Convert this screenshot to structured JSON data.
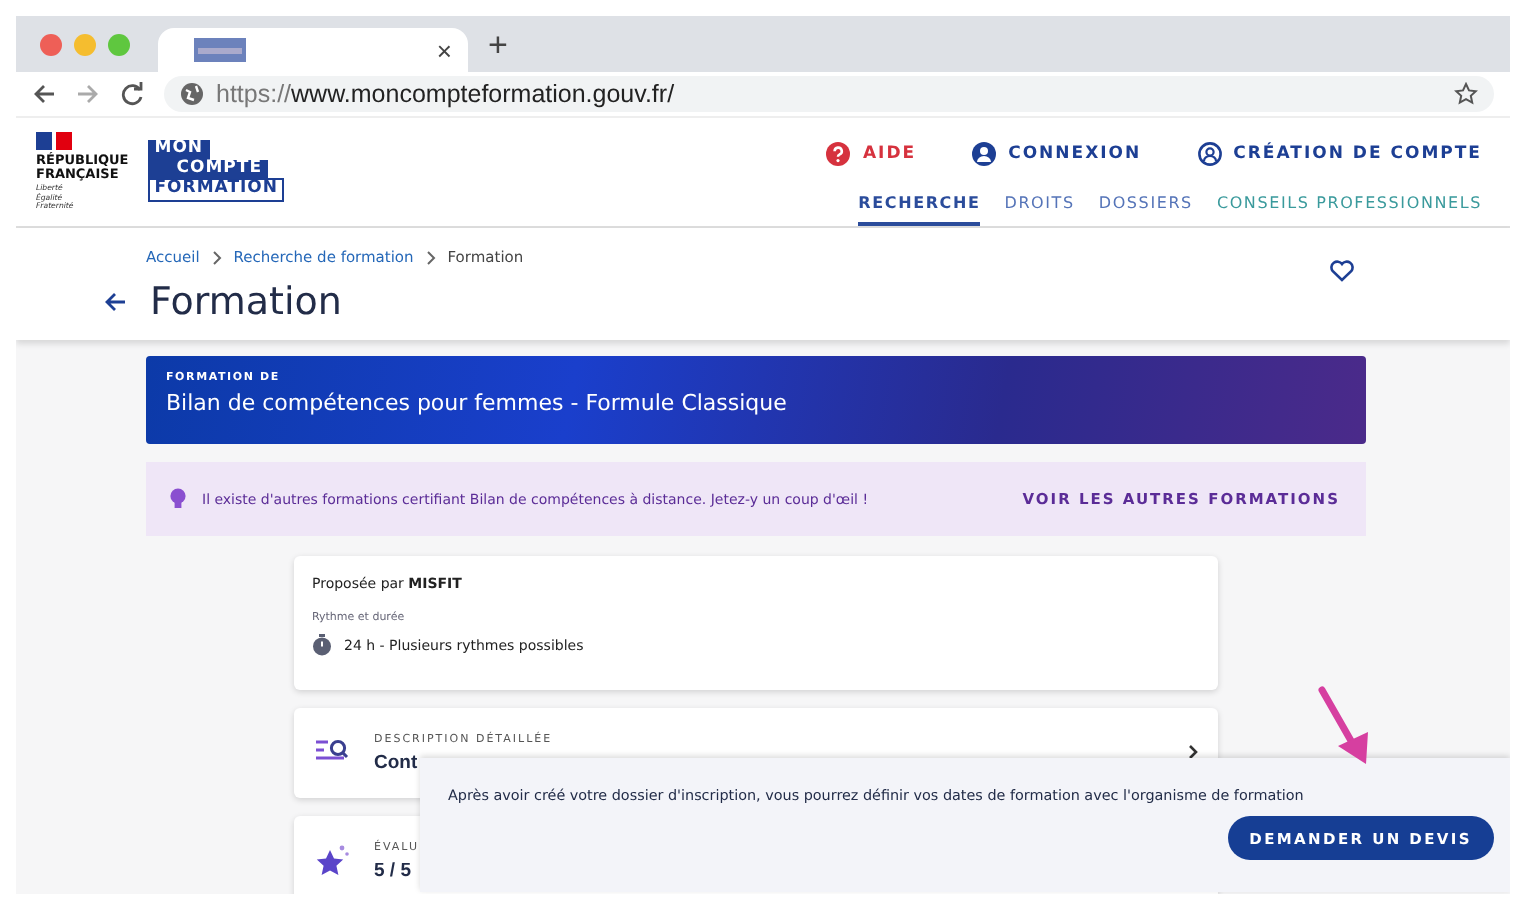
{
  "browser": {
    "tab_close": "×",
    "new_tab": "+",
    "url_scheme": "https://",
    "url_host": "www.moncompteformation.gouv.fr/"
  },
  "header": {
    "republique": [
      "RÉPUBLIQUE",
      "FRANÇAISE"
    ],
    "motto": [
      "Liberté",
      "Égalité",
      "Fraternité"
    ],
    "brand": [
      "MON",
      "COMPTE",
      "FORMATION"
    ],
    "top_links": [
      {
        "label": "AIDE",
        "kind": "help"
      },
      {
        "label": "CONNEXION",
        "kind": "user"
      },
      {
        "label": "CRÉATION DE COMPTE",
        "kind": "account"
      }
    ],
    "nav": [
      {
        "label": "RECHERCHE",
        "selected": true,
        "color": "#2b4c9b"
      },
      {
        "label": "DROITS",
        "selected": false,
        "color": "#5574b8"
      },
      {
        "label": "DOSSIERS",
        "selected": false,
        "color": "#5574b8"
      },
      {
        "label": "CONSEILS PROFESSIONNELS",
        "selected": false,
        "color": "#3a9a9c"
      }
    ]
  },
  "breadcrumb": [
    "Accueil",
    "Recherche de formation",
    "Formation"
  ],
  "title": "Formation",
  "banner": {
    "kicker": "FORMATION DE",
    "title": "Bilan de compétences pour femmes - Formule Classique"
  },
  "tip": {
    "text": "Il existe d'autres formations certifiant Bilan de compétences à distance. Jetez-y un coup d'œil !",
    "link": "VOIR LES AUTRES FORMATIONS"
  },
  "info": {
    "provider": "Proposée par **MISFIT**",
    "rhythm_label": "Rythme et durée",
    "rhythm": "24 h - Plusieurs rythmes possibles"
  },
  "sections": [
    {
      "kind": "description",
      "kicker": "DESCRIPTION DÉTAILLÉE",
      "value": "Cont"
    },
    {
      "kind": "rating",
      "kicker": "ÉVALU",
      "value": "5 / 5"
    }
  ],
  "footer_bar": {
    "text": "Après avoir créé votre dossier d'inscription, vous pourrez définir vos dates de formation avec l'organisme de formation",
    "button": "DEMANDER UN DEVIS"
  }
}
